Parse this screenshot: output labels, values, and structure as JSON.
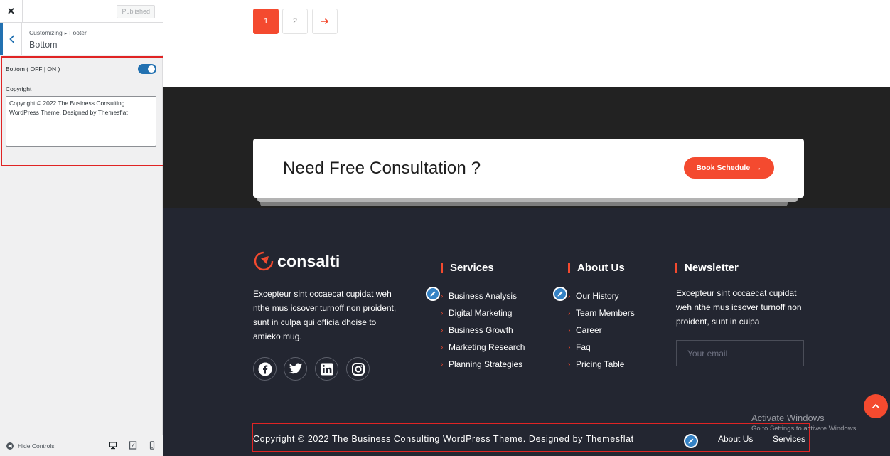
{
  "customizer": {
    "close_glyph": "✕",
    "published_label": "Published",
    "breadcrumb_parent": "Customizing",
    "breadcrumb_sep": "▸",
    "breadcrumb_section": "Footer",
    "section_title": "Bottom",
    "toggle_label": "Bottom ( OFF | ON )",
    "toggle_on": true,
    "copyright_label": "Copyright",
    "copyright_value": "Copyright © 2022 The Business Consulting WordPress Theme. Designed by Themesflat",
    "hide_controls_label": "Hide Controls",
    "devices": [
      "desktop-icon",
      "tablet-icon",
      "mobile-icon"
    ]
  },
  "pagination": {
    "pages": [
      "1",
      "2"
    ],
    "next_glyph": "→",
    "current": "1"
  },
  "cta": {
    "title": "Need Free Consultation ?",
    "button_label": "Book Schedule",
    "button_arrow": "→"
  },
  "footer": {
    "logo_text": "consalti",
    "about_text": "Excepteur sint occaecat cupidat weh nthe mus icsover turnoff non proident, sunt in culpa qui officia dhoise to amieko mug.",
    "social": [
      "facebook-icon",
      "twitter-icon",
      "linkedin-icon",
      "instagram-icon"
    ],
    "services": {
      "title": "Services",
      "items": [
        "Business Analysis",
        "Digital Marketing",
        "Business Growth",
        "Marketing Research",
        "Planning Strategies"
      ]
    },
    "about": {
      "title": "About Us",
      "items": [
        "Our History",
        "Team Members",
        "Career",
        "Faq",
        "Pricing Table"
      ]
    },
    "newsletter": {
      "title": "Newsletter",
      "text": "Excepteur sint occaecat cupidat weh nthe mus icsover turnoff non proident, sunt in culpa",
      "email_placeholder": "Your email"
    },
    "bottom": {
      "copyright": "Copyright © 2022 The Business Consulting WordPress Theme. Designed by Themesflat",
      "links": [
        "About Us",
        "Services"
      ]
    }
  },
  "watermark": {
    "title": "Activate Windows",
    "subtitle": "Go to Settings to activate Windows."
  },
  "colors": {
    "accent": "#f44a2f",
    "wp_blue": "#2271b1",
    "footer_bg": "#232631",
    "band_bg": "#222222",
    "highlight": "#e02424"
  }
}
